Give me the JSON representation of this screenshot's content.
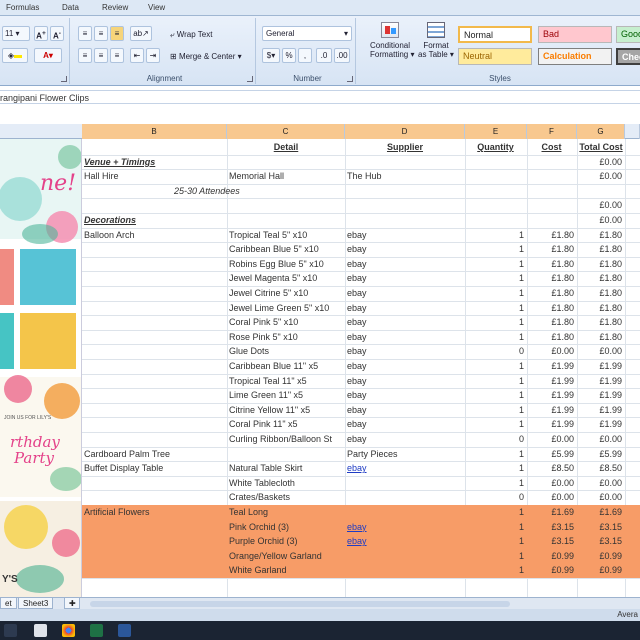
{
  "ribbon": {
    "tabs": [
      "Formulas",
      "Data",
      "Review",
      "View"
    ],
    "font": {
      "size": "11"
    },
    "alignment": {
      "wrap_text": "Wrap Text",
      "merge_center": "Merge & Center",
      "group_label": "Alignment"
    },
    "number": {
      "format": "General",
      "group_label": "Number"
    },
    "styles": {
      "conditional_formatting": "Conditional",
      "conditional_formatting_2": "Formatting",
      "format_as_table": "Format",
      "format_as_table_2": "as Table",
      "normal": "Normal",
      "bad": "Bad",
      "good": "Good",
      "neutral": "Neutral",
      "calculation": "Calculation",
      "check": "Chec",
      "group_label": "Styles"
    }
  },
  "formula_bar": {
    "value": "rangipani Flower Clips"
  },
  "columns": [
    "B",
    "C",
    "D",
    "E",
    "F",
    "G"
  ],
  "table": {
    "header": {
      "detail": "Detail",
      "supplier": "Supplier",
      "quantity": "Quantity",
      "cost": "Cost",
      "total_cost": "Total Cost"
    },
    "rows": [
      {
        "b": "",
        "c": "Detail",
        "d": "Supplier",
        "e": "Quantity",
        "f": "Cost",
        "g": "Total Cost",
        "kind": "header"
      },
      {
        "b": "Venue + Timings",
        "c": "",
        "d": "",
        "e": "",
        "f": "",
        "g": "£0.00",
        "kind": "section"
      },
      {
        "b": "Hall Hire",
        "c": "Memorial Hall",
        "d": "The Hub",
        "e": "",
        "f": "",
        "g": "£0.00"
      },
      {
        "b": "25-30 Attendees",
        "c": "",
        "d": "",
        "e": "",
        "f": "",
        "g": "",
        "kind": "note"
      },
      {
        "b": "",
        "c": "",
        "d": "",
        "e": "",
        "f": "",
        "g": "£0.00"
      },
      {
        "b": "Decorations",
        "c": "",
        "d": "",
        "e": "",
        "f": "",
        "g": "£0.00",
        "kind": "section"
      },
      {
        "b": "Balloon Arch",
        "c": "Tropical Teal 5\" x10",
        "d": "ebay",
        "e": "1",
        "f": "£1.80",
        "g": "£1.80"
      },
      {
        "b": "",
        "c": "Caribbean Blue 5\" x10",
        "d": "ebay",
        "e": "1",
        "f": "£1.80",
        "g": "£1.80"
      },
      {
        "b": "",
        "c": "Robins Egg Blue 5\" x10",
        "d": "ebay",
        "e": "1",
        "f": "£1.80",
        "g": "£1.80"
      },
      {
        "b": "",
        "c": "Jewel Magenta 5\" x10",
        "d": "ebay",
        "e": "1",
        "f": "£1.80",
        "g": "£1.80"
      },
      {
        "b": "",
        "c": "Jewel Citrine 5\" x10",
        "d": "ebay",
        "e": "1",
        "f": "£1.80",
        "g": "£1.80"
      },
      {
        "b": "",
        "c": "Jewel Lime Green 5\" x10",
        "d": "ebay",
        "e": "1",
        "f": "£1.80",
        "g": "£1.80"
      },
      {
        "b": "",
        "c": "Coral Pink 5\" x10",
        "d": "ebay",
        "e": "1",
        "f": "£1.80",
        "g": "£1.80"
      },
      {
        "b": "",
        "c": "Rose Pink 5\" x10",
        "d": "ebay",
        "e": "1",
        "f": "£1.80",
        "g": "£1.80"
      },
      {
        "b": "",
        "c": "Glue Dots",
        "d": "ebay",
        "e": "0",
        "f": "£0.00",
        "g": "£0.00"
      },
      {
        "b": "",
        "c": "Caribbean Blue 11\" x5",
        "d": "ebay",
        "e": "1",
        "f": "£1.99",
        "g": "£1.99"
      },
      {
        "b": "",
        "c": "Tropical Teal 11\" x5",
        "d": "ebay",
        "e": "1",
        "f": "£1.99",
        "g": "£1.99"
      },
      {
        "b": "",
        "c": "Lime Green 11\" x5",
        "d": "ebay",
        "e": "1",
        "f": "£1.99",
        "g": "£1.99"
      },
      {
        "b": "",
        "c": "Citrine Yellow 11\" x5",
        "d": "ebay",
        "e": "1",
        "f": "£1.99",
        "g": "£1.99"
      },
      {
        "b": "",
        "c": "Coral Pink 11\" x5",
        "d": "ebay",
        "e": "1",
        "f": "£1.99",
        "g": "£1.99"
      },
      {
        "b": "",
        "c": "Curling Ribbon/Balloon St",
        "d": "ebay",
        "e": "0",
        "f": "£0.00",
        "g": "£0.00"
      },
      {
        "b": "Cardboard Palm Tree",
        "c": "",
        "d": "Party Pieces",
        "e": "1",
        "f": "£5.99",
        "g": "£5.99"
      },
      {
        "b": "Buffet Display Table",
        "c": "Natural Table Skirt",
        "d": "ebay",
        "e": "1",
        "f": "£8.50",
        "g": "£8.50",
        "link": true
      },
      {
        "b": "",
        "c": "White Tablecloth",
        "d": "",
        "e": "1",
        "f": "£0.00",
        "g": "£0.00"
      },
      {
        "b": "",
        "c": "Crates/Baskets",
        "d": "",
        "e": "0",
        "f": "£0.00",
        "g": "£0.00"
      },
      {
        "b": "Artificial Flowers",
        "c": "Teal Long",
        "d": "",
        "e": "1",
        "f": "£1.69",
        "g": "£1.69",
        "kind": "highlight"
      },
      {
        "b": "",
        "c": "Pink Orchid (3)",
        "d": "ebay",
        "e": "1",
        "f": "£3.15",
        "g": "£3.15",
        "kind": "highlight",
        "link": true
      },
      {
        "b": "",
        "c": "Purple Orchid (3)",
        "d": "ebay",
        "e": "1",
        "f": "£3.15",
        "g": "£3.15",
        "kind": "highlight",
        "link": true
      },
      {
        "b": "",
        "c": "Orange/Yellow Garland",
        "d": "",
        "e": "1",
        "f": "£0.99",
        "g": "£0.99",
        "kind": "highlight"
      },
      {
        "b": "",
        "c": "White Garland",
        "d": "",
        "e": "1",
        "f": "£0.99",
        "g": "£0.99",
        "kind": "highlight"
      }
    ]
  },
  "image_strip": {
    "text_1": "ne!",
    "text_2": "JOIN US FOR LILY'S",
    "text_3": "rthday",
    "text_4": "Party",
    "text_5": "Y'S"
  },
  "sheet_tabs": {
    "tab_1": "et",
    "tab_2": "Sheet3"
  },
  "status": {
    "text": "Avera"
  },
  "colors": {
    "highlight": "#f79c67",
    "selected_header": "#f8c88f",
    "link": "#1f3cc4"
  }
}
